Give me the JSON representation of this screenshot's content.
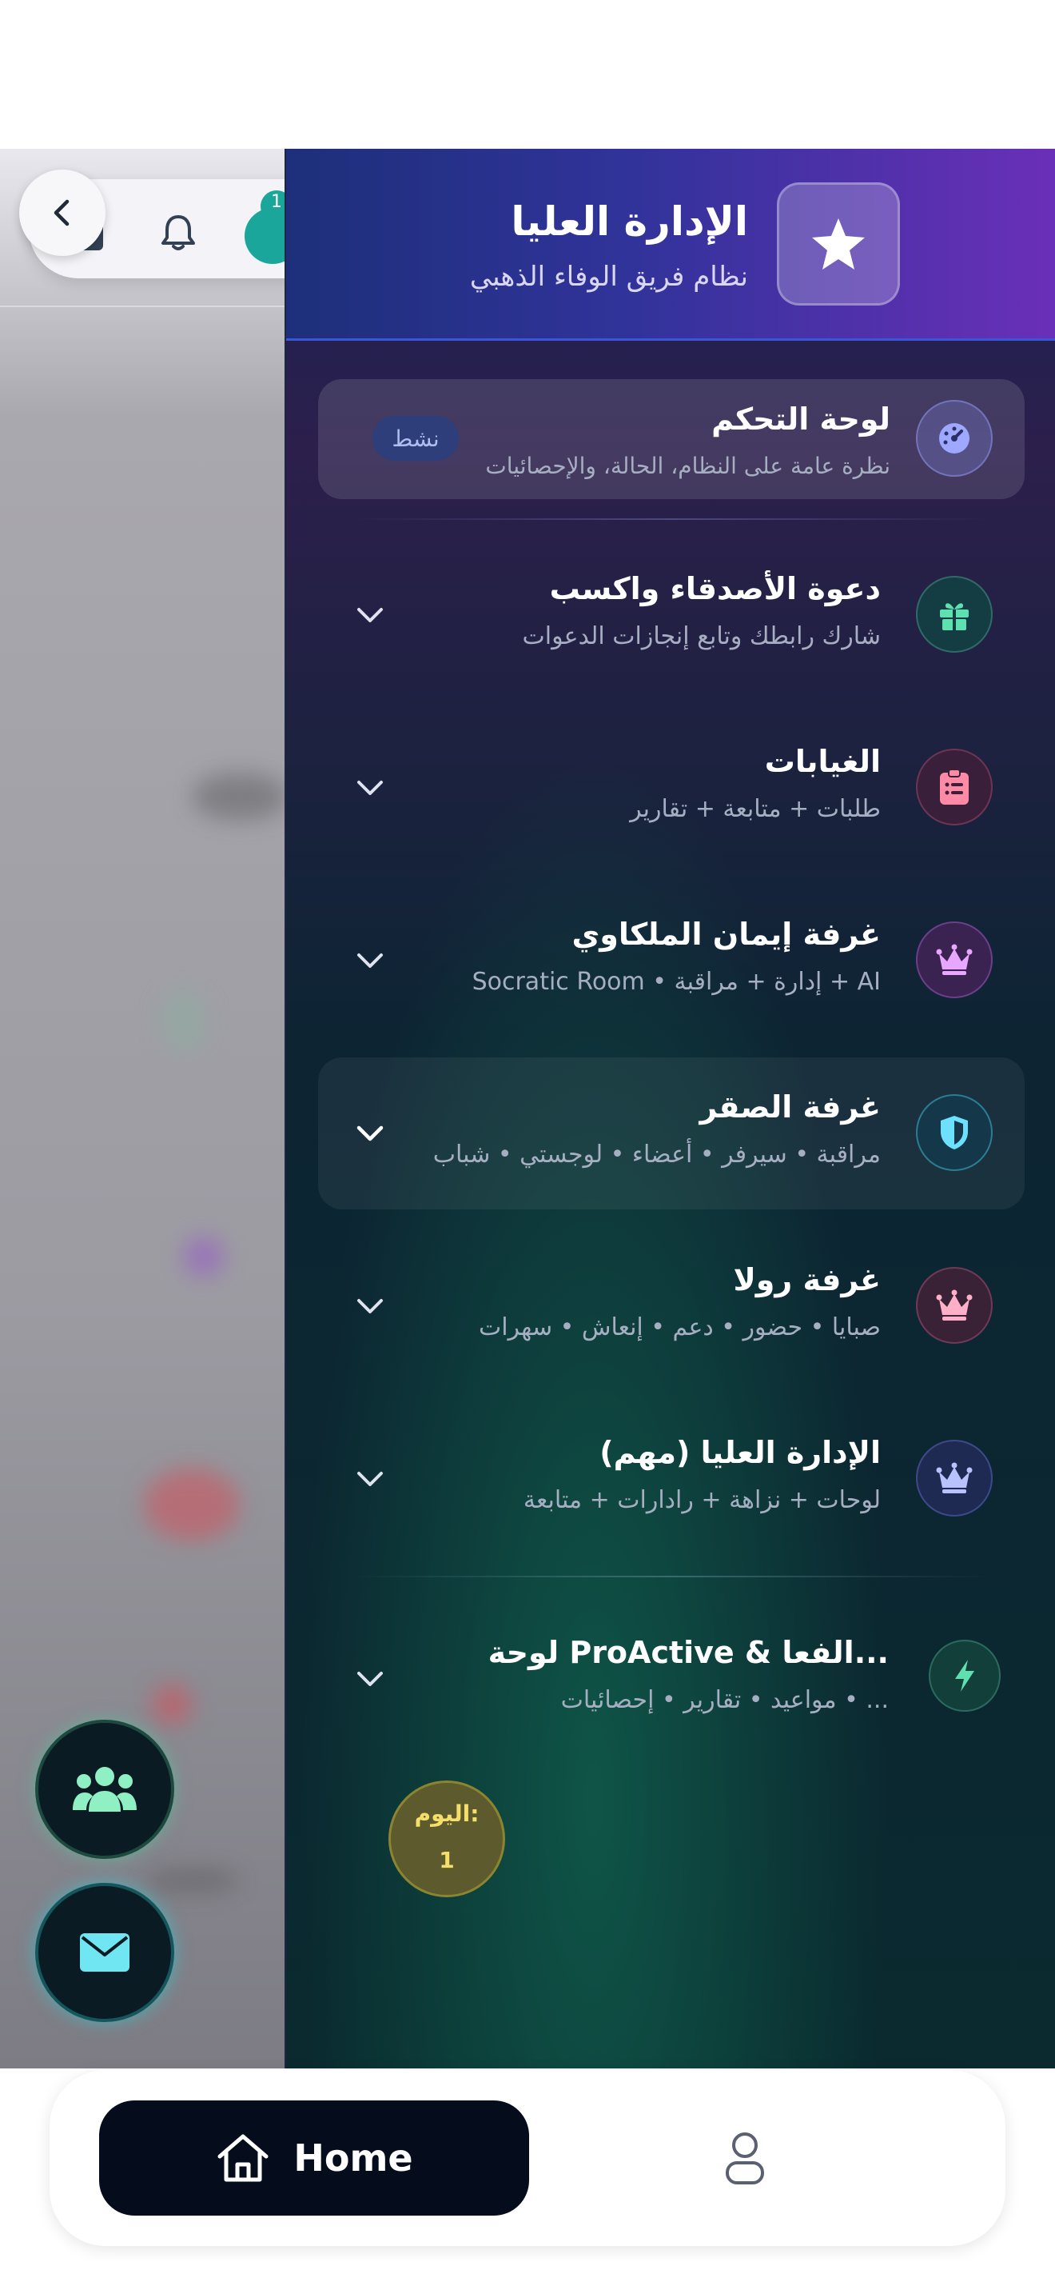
{
  "background_page": {
    "notification_count": "1"
  },
  "drawer": {
    "header": {
      "title": "الإدارة العليا",
      "subtitle": "نظام فريق الوفاء الذهبي",
      "icon": "star-icon"
    },
    "items": [
      {
        "title": "لوحة التحكم",
        "subtitle": "نظرة عامة على النظام، الحالة، والإحصائيات",
        "status": "نشط",
        "icon": "speedometer-icon",
        "icon_color": "#9ea8ff",
        "active": true
      },
      {
        "title": "دعوة الأصدقاء واكسب",
        "subtitle": "شارك رابطك وتابع إنجازات الدعوات",
        "icon": "gift-icon",
        "icon_color": "#5ee0b0"
      },
      {
        "title": "الغيابات",
        "subtitle": "طلبات + متابعة + تقارير",
        "icon": "clipboard-list-icon",
        "icon_color": "#ff8aa6"
      },
      {
        "title": "غرفة إيمان الملكاوي",
        "subtitle": "Socratic Room • إدارة + مراقبة + AI",
        "icon": "crown-icon",
        "icon_color": "#e8a6ff"
      },
      {
        "title": "غرفة الصقر",
        "subtitle": "مراقبة • سيرفر • أعضاء • لوجستي • شباب",
        "icon": "shield-icon",
        "icon_color": "#6ee0ff",
        "highlight": true
      },
      {
        "title": "غرفة رولا",
        "subtitle": "صبايا • حضور • دعم • إنعاش • سهرات",
        "icon": "crown-icon",
        "icon_color": "#ffb0c8"
      },
      {
        "title": "الإدارة العليا (مهم)",
        "subtitle": "لوحات + نزاهة + رادارات + متابعة",
        "icon": "crown-icon",
        "icon_color": "#b8c2ff"
      },
      {
        "title": "لوحة ProActive & الفعا...",
        "subtitle": "مواعيد • تقارير • إحصائيات • ...",
        "icon": "bolt-icon",
        "icon_color": "#5ee0b0",
        "badge_label": "اليوم:",
        "badge_value": "1"
      }
    ]
  },
  "bottom_nav": {
    "home_label": "Home",
    "home_icon": "home-icon",
    "profile_icon": "user-icon"
  }
}
